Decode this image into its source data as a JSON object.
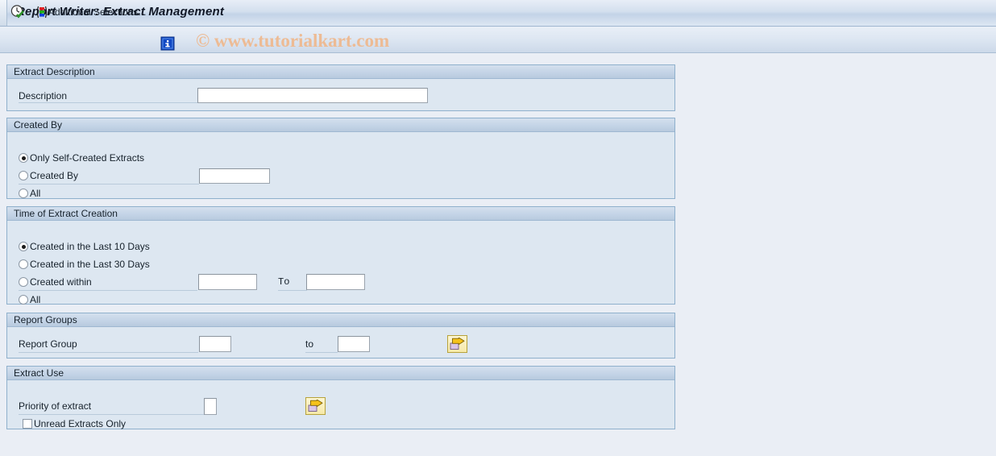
{
  "window": {
    "title": "Report Writer: Extract Management"
  },
  "toolbar": {
    "execute_icon": "clock-check-icon",
    "additional_selections_icon": "color-bars-icon",
    "additional_selections_label": "Additional Selections...",
    "info_icon": "info-icon",
    "watermark": "© www.tutorialkart.com"
  },
  "panels": {
    "extract_description": {
      "title": "Extract Description",
      "description_label": "Description",
      "description_value": "",
      "description_placeholder": ""
    },
    "created_by": {
      "title": "Created By",
      "options": [
        {
          "label": "Only Self-Created Extracts",
          "selected": true
        },
        {
          "label": "Created By",
          "selected": false
        },
        {
          "label": "All",
          "selected": false
        }
      ],
      "created_by_value": "",
      "created_by_placeholder": ""
    },
    "time_of_extract_creation": {
      "title": "Time of Extract Creation",
      "options": [
        {
          "label": "Created in the Last 10 Days",
          "selected": true
        },
        {
          "label": "Created in the Last 30 Days",
          "selected": false
        },
        {
          "label": "Created within",
          "selected": false
        },
        {
          "label": "All",
          "selected": false
        }
      ],
      "from_value": "",
      "to_label": "To",
      "to_value": ""
    },
    "report_groups": {
      "title": "Report Groups",
      "report_group_label": "Report Group",
      "from_value": "",
      "to_label": "to",
      "to_value": "",
      "multi_select_icon": "multiple-selection-arrow-icon"
    },
    "extract_use": {
      "title": "Extract Use",
      "priority_label": "Priority of extract",
      "priority_value": "",
      "multi_select_icon": "multiple-selection-arrow-icon",
      "unread_label": "Unread Extracts Only",
      "unread_checked": false
    }
  },
  "colors": {
    "page_background": "#eaeef5",
    "panel_body": "#dde7f1",
    "panel_header": "#c3d3e6",
    "panel_border": "#8fb0cc",
    "watermark": "#edbb94",
    "accent_button": "#f6e9a8"
  }
}
